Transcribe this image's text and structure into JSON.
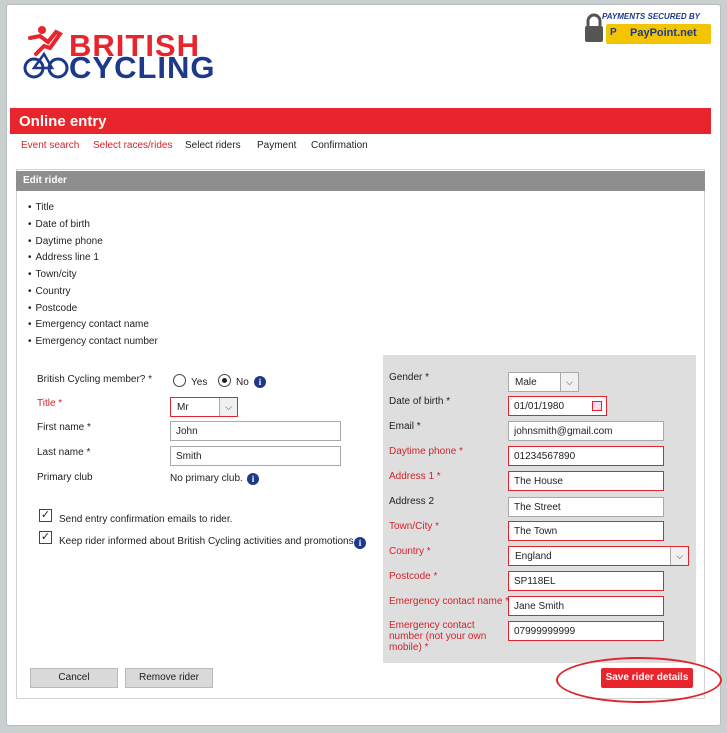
{
  "brand": {
    "line1": "BRITISH",
    "line2": "CYCLING",
    "payments_secured": "PAYMENTS SECURED BY",
    "paypoint_short": "P",
    "paypoint_name": "PayPoint.net"
  },
  "header": {
    "title": "Online entry"
  },
  "nav": [
    {
      "label": "Event search"
    },
    {
      "label": "Select races/rides"
    },
    {
      "label": "Select riders"
    },
    {
      "label": "Payment"
    },
    {
      "label": "Confirmation"
    }
  ],
  "panel": {
    "title": "Edit rider"
  },
  "errors": [
    "Title",
    "Date of birth",
    "Daytime phone",
    "Address line 1",
    "Town/city",
    "Country",
    "Postcode",
    "Emergency contact name",
    "Emergency contact number"
  ],
  "left": {
    "member_label": "British Cycling member? *",
    "yes": "Yes",
    "no": "No",
    "title_label": "Title *",
    "title_value": "Mr",
    "first_label": "First name *",
    "first_value": "John",
    "last_label": "Last name *",
    "last_value": "Smith",
    "club_label": "Primary club",
    "club_value": "No primary club.",
    "check1": "Send entry confirmation emails to rider.",
    "check2": "Keep rider informed about British Cycling activities and promotions."
  },
  "right": {
    "gender_label": "Gender *",
    "gender_value": "Male",
    "dob_label": "Date of birth *",
    "dob_value": "01/01/1980",
    "email_label": "Email *",
    "email_value": "johnsmith@gmail.com",
    "phone_label": "Daytime phone *",
    "phone_value": "01234567890",
    "addr1_label": "Address 1 *",
    "addr1_value": "The House",
    "addr2_label": "Address 2",
    "addr2_value": "The Street",
    "town_label": "Town/City *",
    "town_value": "The Town",
    "country_label": "Country *",
    "country_value": "England",
    "postcode_label": "Postcode *",
    "postcode_value": "SP118EL",
    "ec_name_label": "Emergency contact name *",
    "ec_name_value": "Jane Smith",
    "ec_num_label_1": "Emergency contact",
    "ec_num_label_2": "number (not your own",
    "ec_num_label_3": "mobile) *",
    "ec_num_value": "07999999999"
  },
  "buttons": {
    "cancel": "Cancel",
    "remove": "Remove rider",
    "save": "Save rider details"
  },
  "colors": {
    "brand_red": "#e8242c",
    "brand_blue": "#1d3a8a",
    "paypoint_yellow": "#f2c500"
  }
}
